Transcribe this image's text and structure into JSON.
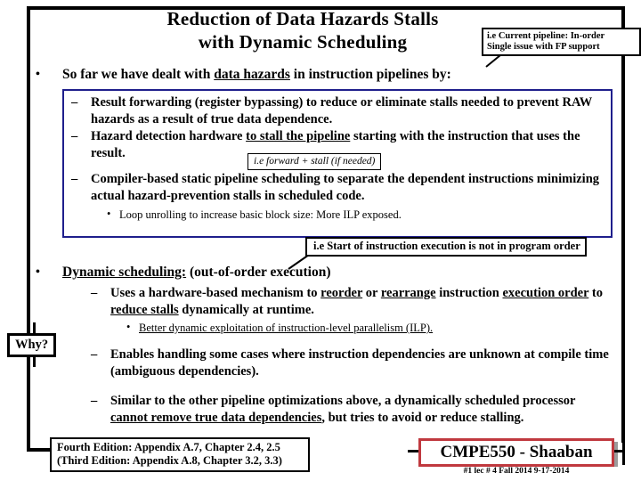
{
  "title": {
    "line1": "Reduction of Data Hazards Stalls",
    "line2": "with Dynamic Scheduling"
  },
  "callout_top": {
    "line1": "i.e Current pipeline: In-order",
    "line2": "Single issue with FP support"
  },
  "bullet_main_1": {
    "pre": "So far we have dealt with ",
    "underlined": "data hazards",
    "post": " in instruction pipelines by:"
  },
  "blue_box": {
    "items": [
      {
        "text_a": "Result forwarding (register bypassing) to reduce or eliminate stalls needed to prevent RAW hazards as a result of true data dependence."
      },
      {
        "pre": "Hazard detection hardware ",
        "underlined": "to stall the pipeline",
        "post": " starting with the instruction that uses the result."
      },
      {
        "text_a": "Compiler-based static pipeline scheduling to separate the dependent instructions minimizing actual hazard-prevention stalls in scheduled code."
      }
    ],
    "sub_bullet": "Loop unrolling to increase basic block size:  More ILP exposed.",
    "inline_note": "i.e  forward  +  stall (if needed)"
  },
  "callout_mid": {
    "text": "i.e  Start of instruction execution is not in program order"
  },
  "bullet_main_2": {
    "underlined": "Dynamic scheduling:",
    "post": "  (out-of-order execution)"
  },
  "dynamic_items": [
    {
      "p1": "Uses a hardware-based mechanism  to ",
      "u1": "reorder",
      "p2": " or ",
      "u2": "rearrange",
      "p3": " instruction ",
      "u3": "execution order",
      "p4": " to ",
      "u4": "reduce stalls",
      "p5": " dynamically at runtime."
    },
    {
      "p1": "Enables handling some cases where instruction dependencies are unknown at compile time (ambiguous dependencies)."
    },
    {
      "p1": "Similar to the other pipeline optimizations above, a dynamically scheduled processor ",
      "u1": "cannot remove true data dependencies",
      "p2": ", but tries to avoid or reduce stalling."
    }
  ],
  "dynamic_sub_bullet": "Better dynamic exploitation of instruction-level parallelism (ILP).",
  "why_box": {
    "label": "Why?"
  },
  "reference_box": {
    "line1": "Fourth Edition: Appendix A.7, Chapter 2.4, 2.5",
    "line2": "(Third Edition: Appendix A.8,  Chapter 3.2,  3.3)"
  },
  "brand": {
    "course": "CMPE550 - Shaaban",
    "footer": "#1  lec # 4 Fall 2014   9-17-2014",
    "border_color": "#c0393f"
  },
  "bullet_glyphs": {
    "dot": "•",
    "dash": "–"
  }
}
